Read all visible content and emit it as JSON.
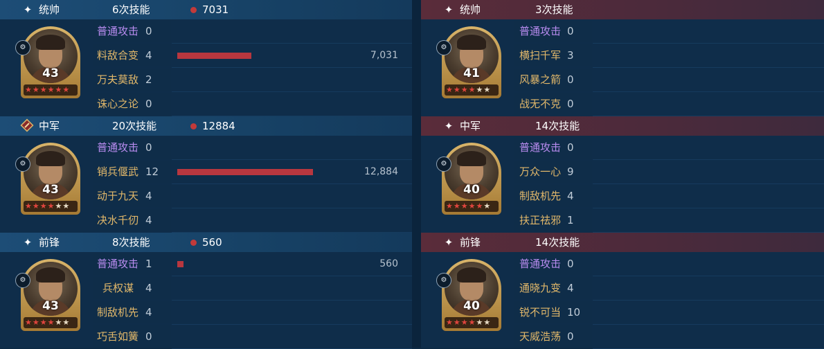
{
  "colors": {
    "bar": "#b8373f",
    "normal_attack": "#b98cf0",
    "skill": "#e2b86a",
    "star_filled": "#e0453e",
    "star_empty": "#e8dcc6"
  },
  "left": {
    "sections": [
      {
        "role_icon": "sparkle-icon",
        "role": "统帅",
        "skill_count": "6次技能",
        "damage_total": "7031",
        "level": "43",
        "stars_filled": 6,
        "stars_total": 6,
        "skills": [
          {
            "name": "普通攻击",
            "uses": "0",
            "type": "normal"
          },
          {
            "name": "料敌合变",
            "uses": "4",
            "type": "skill",
            "damage": 7031,
            "damage_label": "7,031"
          },
          {
            "name": "万夫莫敌",
            "uses": "2",
            "type": "skill"
          },
          {
            "name": "诛心之论",
            "uses": "0",
            "type": "skill"
          }
        ]
      },
      {
        "role_icon": "banner-icon",
        "role": "中军",
        "skill_count": "20次技能",
        "damage_total": "12884",
        "level": "43",
        "stars_filled": 4,
        "stars_total": 6,
        "skills": [
          {
            "name": "普通攻击",
            "uses": "0",
            "type": "normal"
          },
          {
            "name": "销兵偃武",
            "uses": "12",
            "type": "skill",
            "damage": 12884,
            "damage_label": "12,884"
          },
          {
            "name": "动于九天",
            "uses": "4",
            "type": "skill"
          },
          {
            "name": "决水千仞",
            "uses": "4",
            "type": "skill"
          }
        ]
      },
      {
        "role_icon": "sparkle-icon",
        "role": "前锋",
        "skill_count": "8次技能",
        "damage_total": "560",
        "level": "43",
        "stars_filled": 4,
        "stars_total": 6,
        "skills": [
          {
            "name": "普通攻击",
            "uses": "1",
            "type": "normal",
            "damage": 560,
            "damage_label": "560"
          },
          {
            "name": "兵权谋",
            "uses": "4",
            "type": "skill"
          },
          {
            "name": "制敌机先",
            "uses": "4",
            "type": "skill"
          },
          {
            "name": "巧舌如簧",
            "uses": "0",
            "type": "skill"
          }
        ]
      }
    ]
  },
  "right": {
    "sections": [
      {
        "role_icon": "sparkle-icon",
        "role": "统帅",
        "skill_count": "3次技能",
        "level": "41",
        "stars_filled": 4,
        "stars_total": 6,
        "skills": [
          {
            "name": "普通攻击",
            "uses": "0",
            "type": "normal"
          },
          {
            "name": "横扫千军",
            "uses": "3",
            "type": "skill"
          },
          {
            "name": "风暴之箭",
            "uses": "0",
            "type": "skill"
          },
          {
            "name": "战无不克",
            "uses": "0",
            "type": "skill"
          }
        ]
      },
      {
        "role_icon": "sparkle-icon",
        "role": "中军",
        "skill_count": "14次技能",
        "level": "40",
        "stars_filled": 5,
        "stars_total": 6,
        "skills": [
          {
            "name": "普通攻击",
            "uses": "0",
            "type": "normal"
          },
          {
            "name": "万众一心",
            "uses": "9",
            "type": "skill"
          },
          {
            "name": "制敌机先",
            "uses": "4",
            "type": "skill"
          },
          {
            "name": "扶正祛邪",
            "uses": "1",
            "type": "skill"
          }
        ]
      },
      {
        "role_icon": "sparkle-icon",
        "role": "前锋",
        "skill_count": "14次技能",
        "level": "40",
        "stars_filled": 4,
        "stars_total": 6,
        "skills": [
          {
            "name": "普通攻击",
            "uses": "0",
            "type": "normal"
          },
          {
            "name": "通晓九变",
            "uses": "4",
            "type": "skill"
          },
          {
            "name": "锐不可当",
            "uses": "10",
            "type": "skill"
          },
          {
            "name": "天威浩荡",
            "uses": "0",
            "type": "skill"
          }
        ]
      }
    ]
  }
}
